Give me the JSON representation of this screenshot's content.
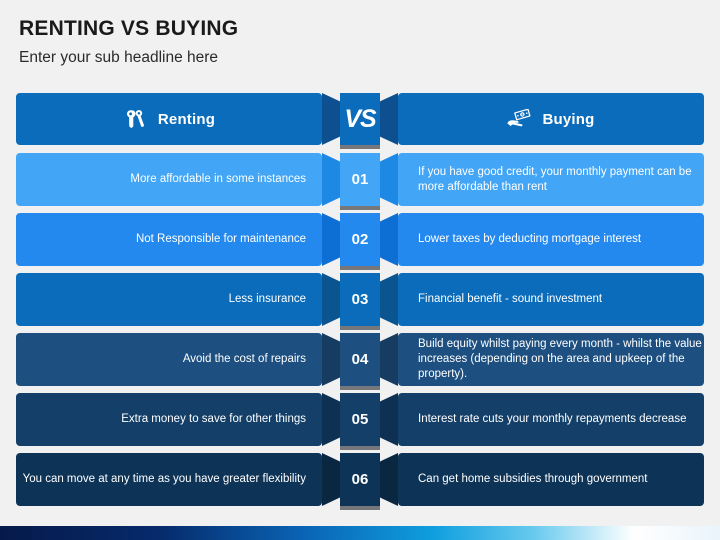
{
  "slide": {
    "title": "RENTING VS BUYING",
    "subtitle": "Enter your sub headline here"
  },
  "header": {
    "left_label": "Renting",
    "left_icon": "keys-icon",
    "right_label": "Buying",
    "right_icon": "money-hand-icon",
    "center_label": "VS",
    "bar_color": "#0a6cba",
    "wing_color": "#0d4f8f"
  },
  "rows": [
    {
      "number": "01",
      "left": "More affordable in some instances",
      "right": "If you have good credit, your monthly payment can be more affordable than rent",
      "color": "#42a5f5",
      "wing_color": "#1e88e5"
    },
    {
      "number": "02",
      "left": "Not Responsible for maintenance",
      "right": "Lower taxes by deducting mortgage interest",
      "color": "#2489ef",
      "wing_color": "#0d6fd4"
    },
    {
      "number": "03",
      "left": "Less insurance",
      "right": "Financial benefit - sound investment",
      "color": "#0a6cba",
      "wing_color": "#0a5490"
    },
    {
      "number": "04",
      "left": "Avoid the cost of repairs",
      "right": "Build equity whilst paying every month - whilst the value increases (depending on the area and upkeep of the property).",
      "color": "#1d4f80",
      "wing_color": "#163c62"
    },
    {
      "number": "05",
      "left": "Extra money to save for other things",
      "right": "Interest rate cuts your monthly repayments decrease",
      "color": "#133f68",
      "wing_color": "#0e3052"
    },
    {
      "number": "06",
      "left": "You can move at any time as you have greater flexibility",
      "right": "Can get home subsidies through government",
      "color": "#0d3357",
      "wing_color": "#0a2742"
    }
  ],
  "footer": {
    "gradient_from": "#061a4a",
    "gradient_to": "#ffffff"
  }
}
